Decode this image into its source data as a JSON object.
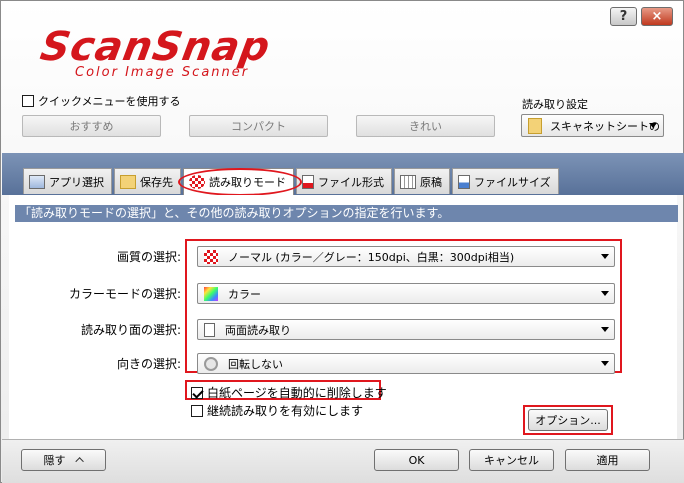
{
  "titlebar": {
    "help_label": "?",
    "close_label": "×"
  },
  "logo": {
    "main": "ScanSnap",
    "sub": "Color Image Scanner"
  },
  "quick_menu": {
    "label": "クイックメニューを使用する",
    "checked": false
  },
  "presets": {
    "recommended": "おすすめ",
    "compact": "コンパクト",
    "fine": "きれい"
  },
  "scan_settings": {
    "label": "読み取り設定",
    "selected": "スキャネットシートの"
  },
  "tabs": [
    {
      "label": "アプリ選択"
    },
    {
      "label": "保存先"
    },
    {
      "label": "読み取りモード"
    },
    {
      "label": "ファイル形式"
    },
    {
      "label": "原稿"
    },
    {
      "label": "ファイルサイズ"
    }
  ],
  "panel": {
    "header": "「読み取りモードの選択」と、その他の読み取りオプションの指定を行います。",
    "image_quality": {
      "label": "画質の選択:",
      "value": "ノーマル (カラー／グレー：150dpi、白黒：300dpi相当)"
    },
    "color_mode": {
      "label": "カラーモードの選択:",
      "value": "カラー"
    },
    "scanning_side": {
      "label": "読み取り面の選択:",
      "value": "両面読み取り"
    },
    "rotation": {
      "label": "向きの選択:",
      "value": "回転しない"
    },
    "blank_page": {
      "label": "白紙ページを自動的に削除します",
      "checked": true
    },
    "continuous": {
      "label": "継続読み取りを有効にします",
      "checked": false
    },
    "option_button": "オプション..."
  },
  "footer": {
    "hide": "隠す",
    "ok": "OK",
    "cancel": "キャンセル",
    "apply": "適用"
  },
  "colors": {
    "accent_red": "#e0171e",
    "band_blue": "#6e86ad",
    "logo_red": "#d4161c"
  }
}
